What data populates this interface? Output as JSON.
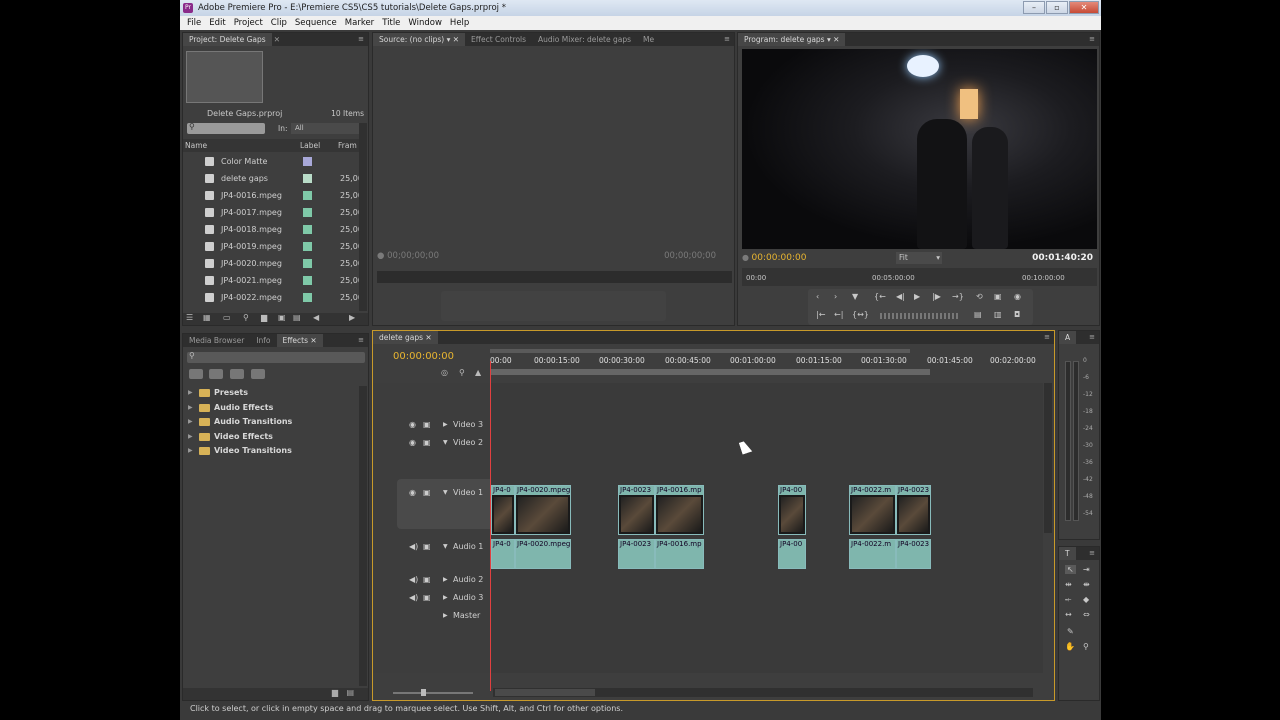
{
  "window": {
    "title": "Adobe Premiere Pro - E:\\Premiere CS5\\CS5 tutorials\\Delete Gaps.prproj *",
    "icon": "Pr"
  },
  "menu": [
    "File",
    "Edit",
    "Project",
    "Clip",
    "Sequence",
    "Marker",
    "Title",
    "Window",
    "Help"
  ],
  "project": {
    "tab": "Project: Delete Gaps",
    "file": "Delete Gaps.prproj",
    "count": "10 Items",
    "in_label": "In:",
    "in_value": "All",
    "columns": {
      "name": "Name",
      "label": "Label",
      "frame": "Fram"
    },
    "items": [
      {
        "name": "Color Matte",
        "label_color": "#a8a8d8",
        "frame": ""
      },
      {
        "name": "delete gaps",
        "label_color": "#b9dcc8",
        "frame": "25,00"
      },
      {
        "name": "JP4-0016.mpeg",
        "label_color": "#7fc9a8",
        "frame": "25,00"
      },
      {
        "name": "JP4-0017.mpeg",
        "label_color": "#7fc9a8",
        "frame": "25,00"
      },
      {
        "name": "JP4-0018.mpeg",
        "label_color": "#7fc9a8",
        "frame": "25,00"
      },
      {
        "name": "JP4-0019.mpeg",
        "label_color": "#7fc9a8",
        "frame": "25,00"
      },
      {
        "name": "JP4-0020.mpeg",
        "label_color": "#7fc9a8",
        "frame": "25,00"
      },
      {
        "name": "JP4-0021.mpeg",
        "label_color": "#7fc9a8",
        "frame": "25,00"
      },
      {
        "name": "JP4-0022.mpeg",
        "label_color": "#7fc9a8",
        "frame": "25,00"
      }
    ]
  },
  "source": {
    "tabs": [
      "Source: (no clips)",
      "Effect Controls",
      "Audio Mixer: delete gaps",
      "Me"
    ],
    "tc_left": "00;00;00;00",
    "tc_right": "00;00;00;00"
  },
  "program": {
    "tab": "Program: delete gaps",
    "tc_current": "00:00:00:00",
    "fit": "Fit",
    "tc_duration": "00:01:40:20",
    "ruler": [
      "00:00",
      "00:05:00:00",
      "00:10:00:00"
    ]
  },
  "effects": {
    "tabs": [
      "Media Browser",
      "Info",
      "Effects"
    ],
    "folders": [
      "Presets",
      "Audio Effects",
      "Audio Transitions",
      "Video Effects",
      "Video Transitions"
    ]
  },
  "timeline": {
    "tab": "delete gaps",
    "tc": "00:00:00:00",
    "ruler": [
      "00:00",
      "00:00:15:00",
      "00:00:30:00",
      "00:00:45:00",
      "00:01:00:00",
      "00:01:15:00",
      "00:01:30:00",
      "00:01:45:00",
      "00:02:00:00"
    ],
    "tracks": [
      "Video 3",
      "Video 2",
      "Video 1",
      "Audio 1",
      "Audio 2",
      "Audio 3",
      "Master"
    ],
    "video_clips": [
      "JP4-0",
      "JP4-0020.mpeg",
      "JP4-0023",
      "JP4-0016.mp",
      "JP4-00",
      "JP4-0022.m",
      "JP4-0023"
    ],
    "audio_clips": [
      "JP4-0",
      "JP4-0020.mpeg",
      "JP4-0023",
      "JP4-0016.mp",
      "JP4-00",
      "JP4-0022.m",
      "JP4-0023"
    ]
  },
  "audiometer": {
    "tab": "A",
    "scale": [
      "0",
      "-6",
      "-12",
      "-18",
      "-24",
      "-30",
      "-36",
      "-42",
      "-48",
      "-54"
    ]
  },
  "tools_tab": "T",
  "status": "Click to select, or click in empty space and drag to marquee select. Use Shift, Alt, and Ctrl for other options."
}
